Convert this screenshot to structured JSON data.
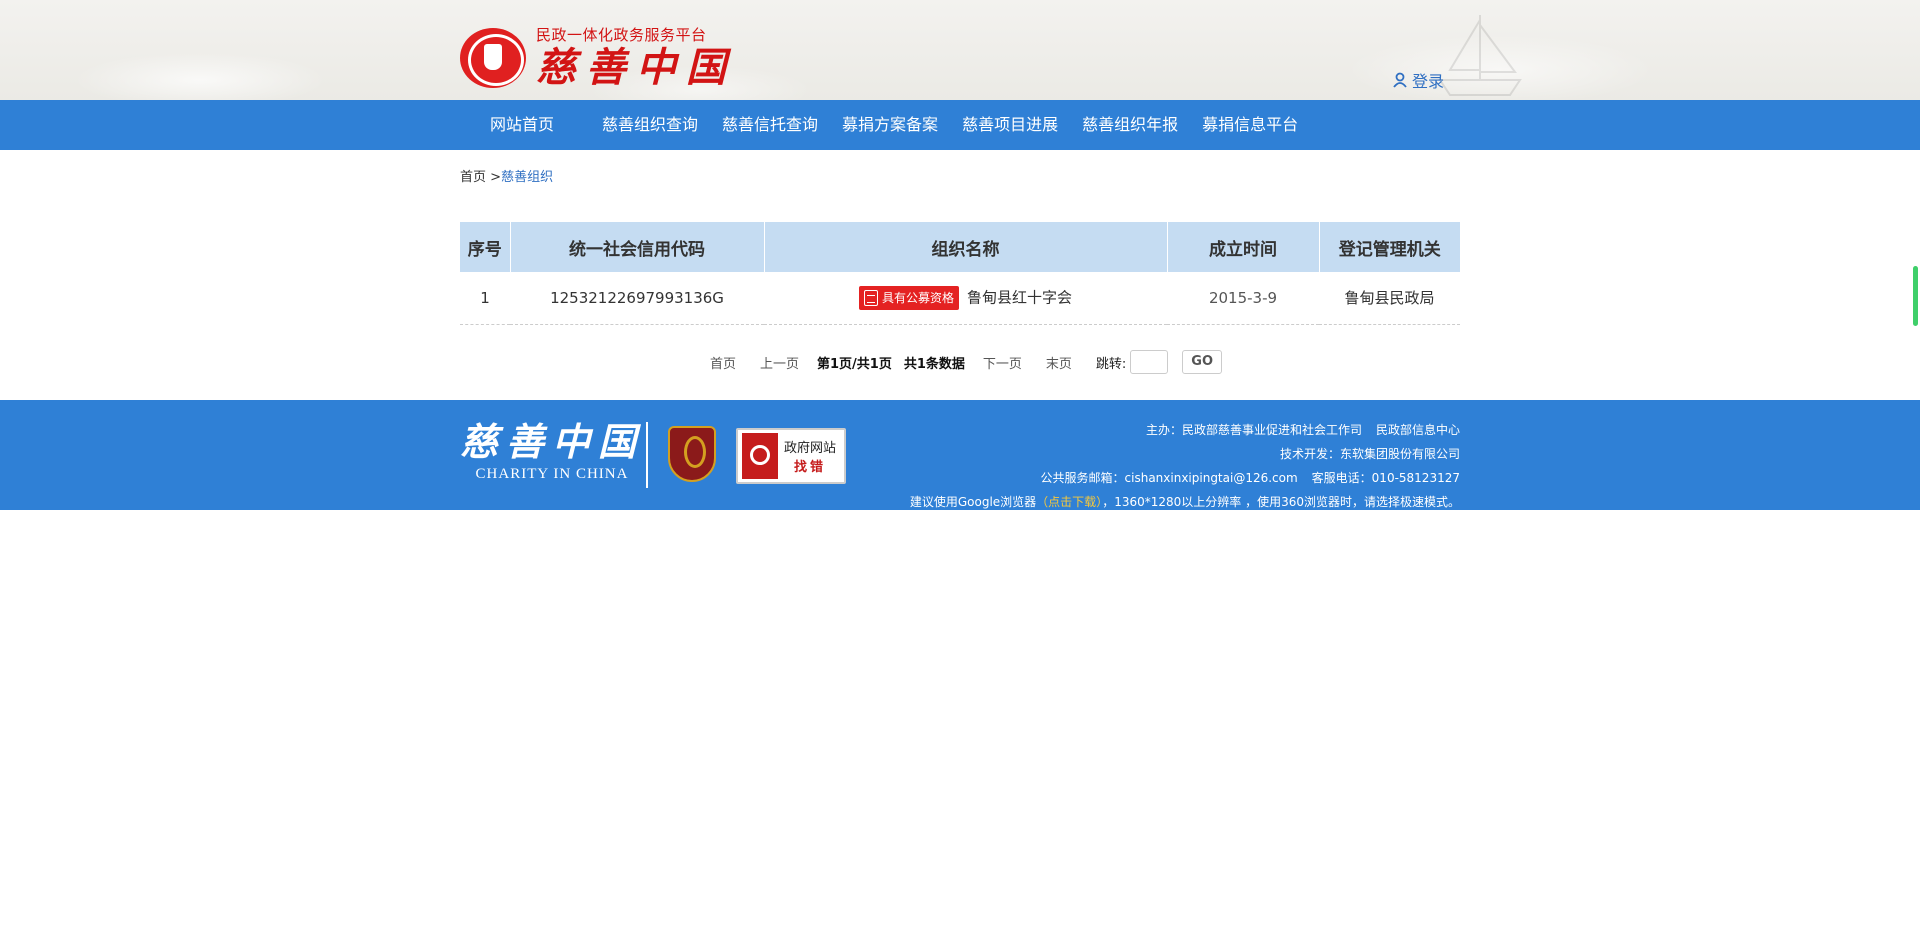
{
  "header": {
    "logo_subtitle": "民政一体化政务服务平台",
    "logo_title": "慈善中国",
    "login_label": "登录"
  },
  "nav": {
    "items": [
      {
        "label": "网站首页"
      },
      {
        "label": "慈善组织查询"
      },
      {
        "label": "慈善信托查询"
      },
      {
        "label": "募捐方案备案"
      },
      {
        "label": "慈善项目进展"
      },
      {
        "label": "慈善组织年报"
      },
      {
        "label": "募捐信息平台"
      }
    ]
  },
  "breadcrumb": {
    "home": "首页",
    "separator": ">",
    "current": "慈善组织"
  },
  "table": {
    "headers": [
      "序号",
      "统一社会信用代码",
      "组织名称",
      "成立时间",
      "登记管理机关"
    ],
    "rows": [
      {
        "index": "1",
        "credit_code": "12532122697993136G",
        "badge": "具有公募资格",
        "name": "鲁甸县红十字会",
        "founded": "2015-3-9",
        "authority": "鲁甸县民政局"
      }
    ]
  },
  "pager": {
    "first": "首页",
    "prev": "上一页",
    "page_info": "第1页/共1页",
    "total": "共1条数据",
    "next": "下一页",
    "last": "末页",
    "jump_label": "跳转:",
    "jump_value": "",
    "go_label": "GO"
  },
  "footer": {
    "logo_cn": "慈善中国",
    "logo_en": "CHARITY IN CHINA",
    "shield_label": "党政机关",
    "gov_button_line1": "政府网站",
    "gov_button_line2": "找错",
    "sponsor": "主办：民政部慈善事业促进和社会工作司",
    "sponsor2": "民政部信息中心",
    "tech": "技术开发：东软集团股份有限公司",
    "email": "公共服务邮箱：cishanxinxipingtai@126.com",
    "phone": "客服电话：010-58123127",
    "tip_prefix": "建议使用Google浏览器",
    "tip_link": "（点击下载）",
    "tip_suffix": "，1360*1280以上分辨率 ，使用360浏览器时，请选择极速模式。"
  },
  "colors": {
    "nav_bg": "#2f80d6",
    "header_row_bg": "#c5dcf2",
    "brand_red": "#d21414",
    "link_blue": "#2f6fc2",
    "footer_link_yellow": "#f6c83c"
  }
}
